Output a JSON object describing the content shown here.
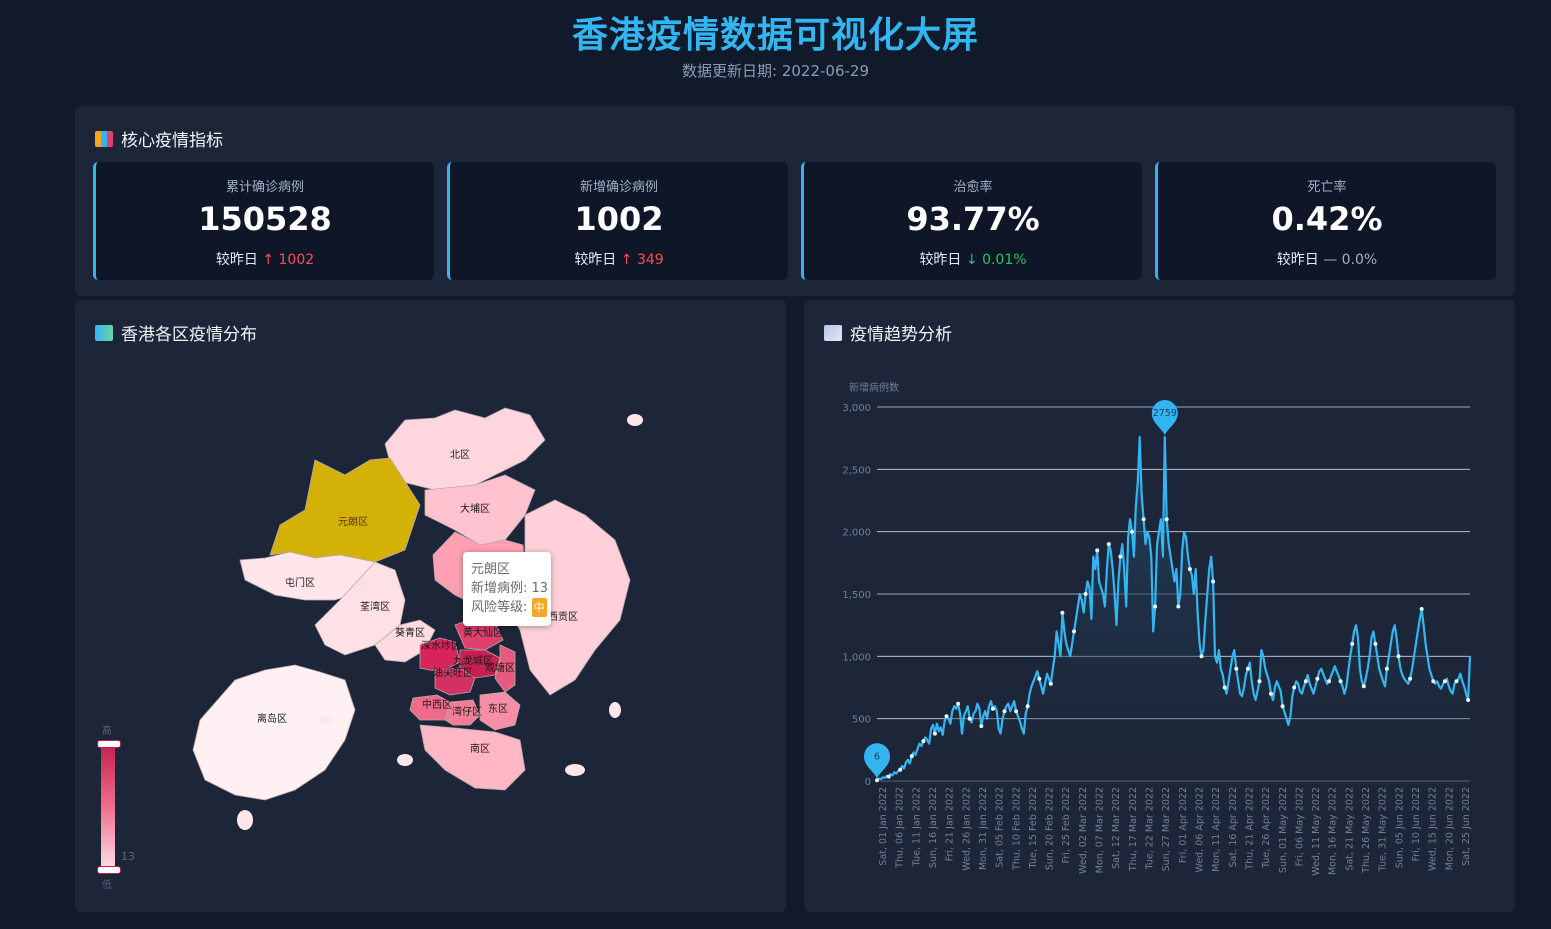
{
  "header": {
    "title": "香港疫情数据可视化大屏",
    "subtitle": "数据更新日期: 2022-06-29"
  },
  "kpi": {
    "title": "核心疫情指标",
    "cards": [
      {
        "label": "累计确诊病例",
        "value": "150528",
        "prefix": "较昨日",
        "arrow": "↑",
        "change": "1002",
        "trend": "up"
      },
      {
        "label": "新增确诊病例",
        "value": "1002",
        "prefix": "较昨日",
        "arrow": "↑",
        "change": "349",
        "trend": "up"
      },
      {
        "label": "治愈率",
        "value": "93.77%",
        "prefix": "较昨日",
        "arrow": "↓",
        "change": "0.01%",
        "trend": "down"
      },
      {
        "label": "死亡率",
        "value": "0.42%",
        "prefix": "较昨日",
        "arrow": "—",
        "change": "0.0%",
        "trend": "flat"
      }
    ]
  },
  "map": {
    "title": "香港各区疫情分布",
    "tooltip": {
      "name": "元朗区",
      "cases_label": "新增病例:",
      "cases": "13",
      "risk_label": "风险等级:",
      "risk": "中"
    },
    "visual_map": {
      "min_label": "低",
      "max_label": "高",
      "current": "13"
    },
    "districts": [
      {
        "name": "北区",
        "color": "#ffd6de"
      },
      {
        "name": "大埔区",
        "color": "#ffc2ce"
      },
      {
        "name": "元朗区",
        "color": "#d4b106",
        "highlighted": true
      },
      {
        "name": "屯门区",
        "color": "#ffe6eb"
      },
      {
        "name": "荃湾区",
        "color": "#ffe0e6"
      },
      {
        "name": "沙田区",
        "color": "#ff9fb2"
      },
      {
        "name": "西贡区",
        "color": "#ffd0da"
      },
      {
        "name": "葵青区",
        "color": "#ffdbe2"
      },
      {
        "name": "深水埗区",
        "color": "#d7245a"
      },
      {
        "name": "黄大仙区",
        "color": "#e0406c"
      },
      {
        "name": "九龙城区",
        "color": "#c81e50"
      },
      {
        "name": "观塘区",
        "color": "#e85a7d"
      },
      {
        "name": "油尖旺区",
        "color": "#d13163"
      },
      {
        "name": "中西区",
        "color": "#f06a8a"
      },
      {
        "name": "湾仔区",
        "color": "#f27d97"
      },
      {
        "name": "东区",
        "color": "#f58ea6"
      },
      {
        "name": "南区",
        "color": "#ffb6c5"
      },
      {
        "name": "离岛区",
        "color": "#fff0f3"
      }
    ]
  },
  "trend": {
    "title": "疫情趋势分析"
  },
  "chart_data": {
    "type": "line",
    "ylabel": "新增病例数",
    "ylim": [
      0,
      3000
    ],
    "yticks": [
      "0",
      "500",
      "1,000",
      "1,500",
      "2,000",
      "2,500",
      "3,000"
    ],
    "xtick_labels": [
      "Sat, 01 Jan 2022",
      "Thu, 06 Jan 2022",
      "Tue, 11 Jan 2022",
      "Sun, 16 Jan 2022",
      "Fri, 21 Jan 2022",
      "Wed, 26 Jan 2022",
      "Mon, 31 Jan 2022",
      "Sat, 05 Feb 2022",
      "Thu, 10 Feb 2022",
      "Tue, 15 Feb 2022",
      "Sun, 20 Feb 2022",
      "Fri, 25 Feb 2022",
      "Wed, 02 Mar 2022",
      "Mon, 07 Mar 2022",
      "Sat, 12 Mar 2022",
      "Thu, 17 Mar 2022",
      "Tue, 22 Mar 2022",
      "Sun, 27 Mar 2022",
      "Fri, 01 Apr 2022",
      "Wed, 06 Apr 2022",
      "Mon, 11 Apr 2022",
      "Sat, 16 Apr 2022",
      "Thu, 21 Apr 2022",
      "Tue, 26 Apr 2022",
      "Sun, 01 May 2022",
      "Fri, 06 May 2022",
      "Wed, 11 May 2022",
      "Mon, 16 May 2022",
      "Sat, 21 May 2022",
      "Thu, 26 May 2022",
      "Tue, 31 May 2022",
      "Sun, 05 Jun 2022",
      "Fri, 10 Jun 2022",
      "Wed, 15 Jun 2022",
      "Mon, 20 Jun 2022",
      "Sat, 25 Jun 2022"
    ],
    "series": [
      {
        "values": [
          6,
          20,
          15,
          30,
          25,
          40,
          35,
          55,
          45,
          70,
          60,
          80,
          90,
          120,
          100,
          150,
          170,
          140,
          200,
          230,
          210,
          260,
          300,
          280,
          320,
          350,
          330,
          300,
          420,
          450,
          380,
          460,
          400,
          430,
          370,
          480,
          520,
          500,
          460,
          560,
          600,
          580,
          620,
          540,
          380,
          520,
          560,
          600,
          500,
          470,
          540,
          560,
          620,
          580,
          440,
          520,
          560,
          500,
          600,
          640,
          580,
          600,
          560,
          420,
          380,
          500,
          560,
          600,
          620,
          560,
          600,
          640,
          560,
          520,
          480,
          420,
          380,
          540,
          600,
          700,
          760,
          800,
          840,
          880,
          820,
          760,
          700,
          780,
          860,
          820,
          780,
          900,
          1000,
          1200,
          1100,
          1000,
          1350,
          1200,
          1100,
          1050,
          1000,
          1100,
          1200,
          1300,
          1400,
          1500,
          1450,
          1350,
          1500,
          1600,
          1550,
          1300,
          1800,
          1700,
          1850,
          1600,
          1550,
          1500,
          1400,
          1700,
          1900,
          1850,
          1700,
          1500,
          1250,
          1600,
          1800,
          1900,
          1700,
          1400,
          1950,
          2100,
          2000,
          1800,
          2200,
          2400,
          2759,
          2300,
          2100,
          1900,
          2000,
          1950,
          1800,
          1200,
          1400,
          1900,
          2000,
          2100,
          1800,
          2759,
          2100,
          1900,
          1800,
          1700,
          1600,
          1700,
          1400,
          1500,
          1850,
          2000,
          1950,
          1800,
          1700,
          1650,
          1500,
          1700,
          1350,
          1100,
          1000,
          1050,
          1300,
          1500,
          1700,
          1800,
          1600,
          1000,
          950,
          1050,
          900,
          850,
          750,
          700,
          800,
          900,
          1000,
          1050,
          900,
          800,
          700,
          680,
          750,
          850,
          900,
          950,
          800,
          700,
          650,
          720,
          800,
          1050,
          1000,
          900,
          850,
          800,
          700,
          650,
          750,
          800,
          760,
          720,
          600,
          550,
          500,
          450,
          520,
          680,
          750,
          800,
          780,
          720,
          700,
          760,
          800,
          850,
          780,
          740,
          700,
          760,
          820,
          880,
          900,
          860,
          820,
          780,
          800,
          840,
          880,
          920,
          880,
          840,
          800,
          760,
          700,
          760,
          880,
          1000,
          1100,
          1200,
          1250,
          1150,
          900,
          800,
          760,
          820,
          900,
          1000,
          1150,
          1200,
          1100,
          1000,
          900,
          850,
          800,
          760,
          900,
          1000,
          1100,
          1200,
          1250,
          1150,
          1000,
          900,
          850,
          820,
          800,
          780,
          820,
          900,
          1000,
          1100,
          1200,
          1300,
          1380,
          1250,
          1100,
          1000,
          900,
          850,
          800,
          780,
          800,
          760,
          740,
          780,
          800,
          820,
          760,
          720,
          700,
          780,
          800,
          820,
          860,
          800,
          760,
          700,
          650,
          1002
        ]
      }
    ],
    "markers": [
      {
        "label": "6"
      },
      {
        "label": "2759"
      }
    ],
    "colors": {
      "line": "#33b5f2",
      "area_top": "#23496c",
      "area_bottom": "#1d2638"
    }
  }
}
